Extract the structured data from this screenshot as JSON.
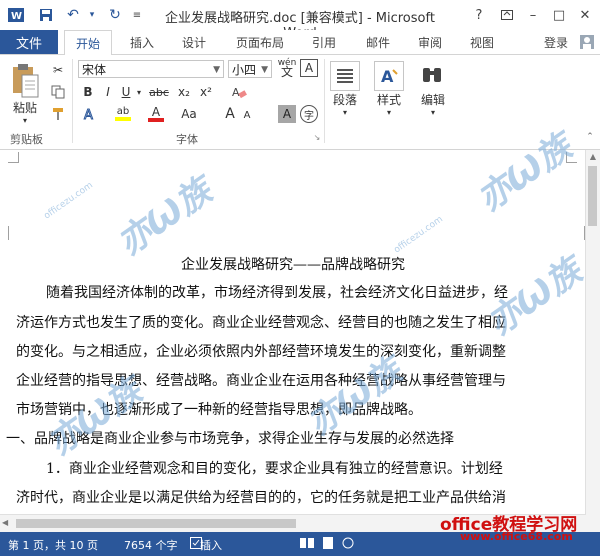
{
  "window": {
    "title": "企业发展战略研究.doc [兼容模式] - Microsoft Word",
    "help": "?",
    "minimize": "–",
    "restore": "□",
    "close": "✕"
  },
  "tabs": {
    "file": "文件",
    "items": [
      "开始",
      "插入",
      "设计",
      "页面布局",
      "引用",
      "邮件",
      "审阅",
      "视图"
    ],
    "login": "登录"
  },
  "ribbon": {
    "clipboard": {
      "paste": "粘贴",
      "label": "剪贴板"
    },
    "font": {
      "name": "宋体",
      "size": "小四",
      "wen": "wén",
      "label": "字体",
      "bold": "B",
      "italic": "I",
      "underline": "U",
      "strike": "abc",
      "sub": "x₂",
      "sup": "x²",
      "font_color": "A",
      "highlight": "ab",
      "grow": "A",
      "shrink": "A",
      "case": "Aa",
      "char_border": "A",
      "char_shade": "A",
      "enclose": "字"
    },
    "paragraph": {
      "label": "段落"
    },
    "styles": {
      "label": "样式"
    },
    "editing": {
      "label": "编辑"
    }
  },
  "document": {
    "title": "企业发展战略研究——品牌战略研究",
    "lines": [
      "随着我国经济体制的改革，市场经济得到发展，社会经济文化日益进步，经",
      "济运作方式也发生了质的变化。商业企业经营观念、经营目的也随之发生了相应",
      "的变化。与之相适应，企业必须依照内外部经营环境发生的深刻变化，重新调整",
      "企业经营的指导思想、经营战略。商业企业在运用各种经营战略从事经营管理与",
      "市场营销中，也逐渐形成了一种新的经营指导思想，即品牌战略。",
      "一、品牌战略是商业企业参与市场竞争，求得企业生存与发展的必然选择",
      "1．商业企业经营观念和目的变化，要求企业具有独立的经营意识。计划经",
      "济时代，商业企业是以满足供给为经营目的的，它的任务就是把工业产品供给消"
    ]
  },
  "status": {
    "page": "第 1 页，共 10 页",
    "words": "7654 个字",
    "mode": "插入"
  },
  "watermark": {
    "site_name": "office教程学习网",
    "site_url": "www.office68.com"
  }
}
